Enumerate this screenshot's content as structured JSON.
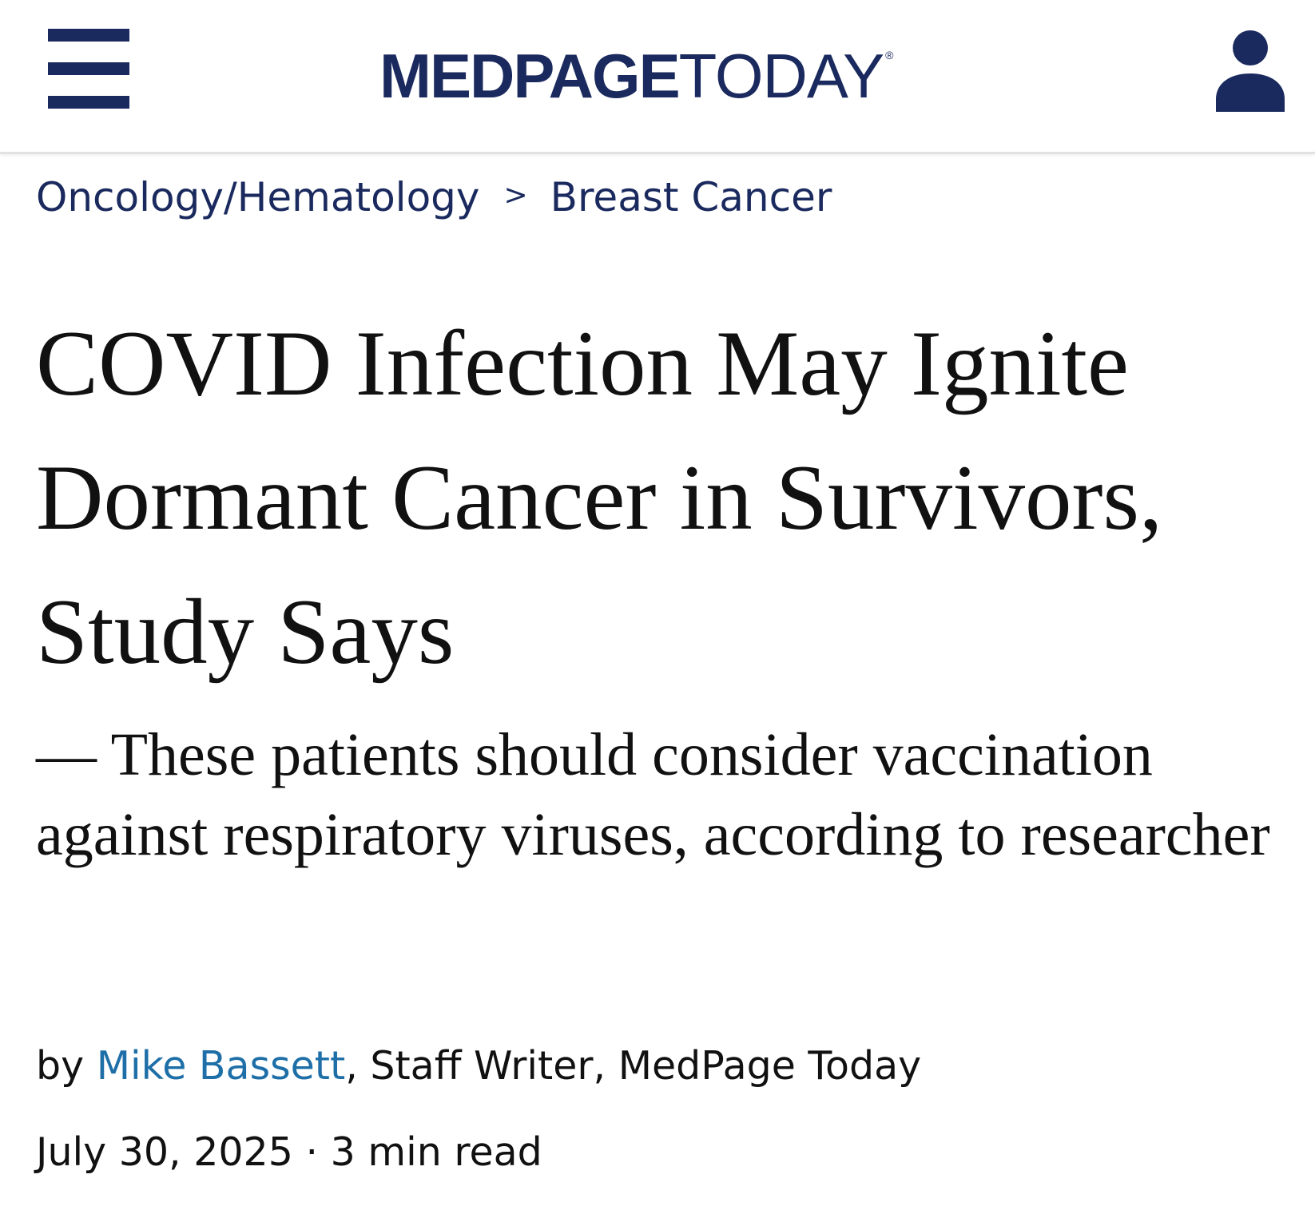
{
  "header": {
    "logo_bold": "MEDPAGE",
    "logo_light": "TODAY",
    "logo_mark": "®",
    "menu_icon": "hamburger-menu-icon",
    "account_icon": "user-account-icon",
    "brand_color": "#1b2a5e"
  },
  "breadcrumb": {
    "parent": "Oncology/Hematology",
    "separator": ">",
    "current": "Breast Cancer"
  },
  "article": {
    "headline": "COVID Infection May Ignite Dormant Cancer in Survivors, Study Says",
    "dek": "— These patients should consider vaccination against respiratory viruses, according to researcher",
    "byline_prefix": "by ",
    "author": "Mike Bassett",
    "author_role": ", Staff Writer, MedPage Today",
    "date": "July 30, 2025",
    "dot": " · ",
    "read_time": "3 min read",
    "author_link_color": "#1e6fa8"
  }
}
